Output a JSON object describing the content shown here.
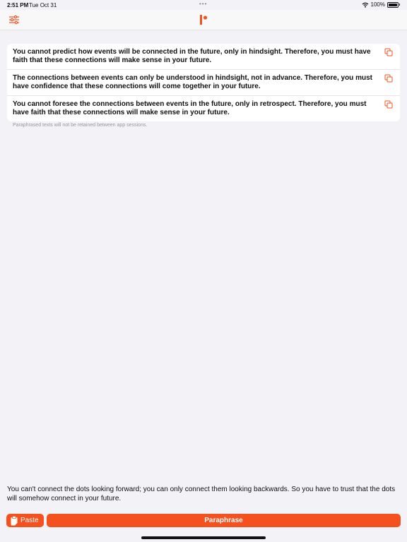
{
  "status": {
    "time": "2:51 PM",
    "date": "Tue Oct 31",
    "battery": "100%"
  },
  "header": {
    "settings_icon": "sliders-icon",
    "logo_icon": "app-logo"
  },
  "results": [
    {
      "text": "You cannot predict how events will be connected in the future, only in hindsight. Therefore, you must have faith that these connections will make sense in your future."
    },
    {
      "text": "The connections between events can only be understood in hindsight, not in advance. Therefore, you must have confidence that these connections will come together in your future."
    },
    {
      "text": "You cannot foresee the connections between events in the future, only in retrospect. Therefore, you must have faith that these connections will make sense in your future."
    }
  ],
  "note": "Paraphrased texts will not be retained between app sessions.",
  "input": {
    "text": "You can't connect the dots looking forward; you can only connect them looking backwards. So you have to trust that the dots will somehow connect in your future."
  },
  "buttons": {
    "paste_label": "Paste",
    "paraphrase_label": "Paraphrase"
  },
  "colors": {
    "accent": "#f4511e",
    "background": "#f2f2f7"
  }
}
